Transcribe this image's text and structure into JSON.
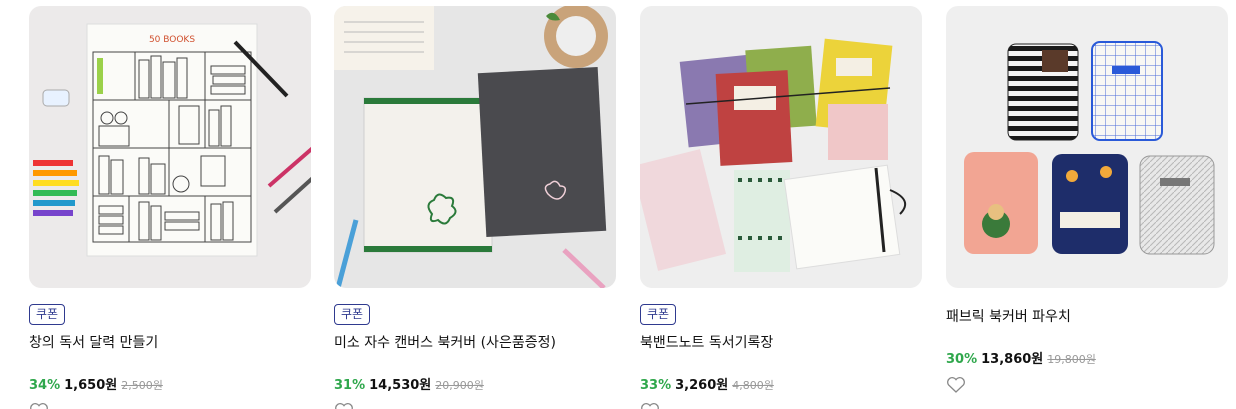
{
  "products": [
    {
      "coupon": "쿠폰",
      "name": "창의 독서 달력 만들기",
      "rate": "34%",
      "price": "1,650원",
      "original": "2,500원",
      "image_text": "50 BOOKS"
    },
    {
      "coupon": "쿠폰",
      "name": "미소 자수 캔버스 북커버 (사은품증정)",
      "rate": "31%",
      "price": "14,530원",
      "original": "20,900원"
    },
    {
      "coupon": "쿠폰",
      "name": "북밴드노트 독서기록장",
      "rate": "33%",
      "price": "3,260원",
      "original": "4,800원"
    },
    {
      "coupon": "",
      "name": "패브릭 북커버 파우치",
      "rate": "30%",
      "price": "13,860원",
      "original": "19,800원"
    }
  ],
  "colors": {
    "coupon_border": "#2f3a8f",
    "discount": "#2fa74c",
    "original_price": "#999999"
  },
  "icons": {
    "wishlist": "heart-outline-icon"
  }
}
